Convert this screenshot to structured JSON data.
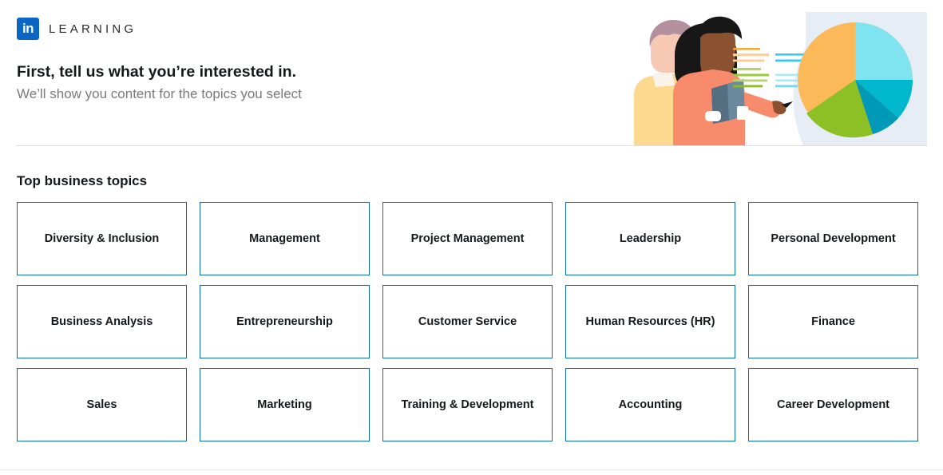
{
  "brand": {
    "mark_text": "in",
    "wordmark": "LEARNING",
    "mark_color": "#0a66c2"
  },
  "header": {
    "headline": "First, tell us what you’re interested in.",
    "subhead": "We’ll show you content for the topics you select"
  },
  "section": {
    "title": "Top business topics"
  },
  "topics": [
    {
      "label": "Diversity & Inclusion"
    },
    {
      "label": "Management"
    },
    {
      "label": "Project Management"
    },
    {
      "label": "Leadership"
    },
    {
      "label": "Personal Development"
    },
    {
      "label": "Business Analysis"
    },
    {
      "label": "Entrepreneurship"
    },
    {
      "label": "Customer Service"
    },
    {
      "label": "Human Resources (HR)"
    },
    {
      "label": "Finance"
    },
    {
      "label": "Sales"
    },
    {
      "label": "Marketing"
    },
    {
      "label": "Training & Development"
    },
    {
      "label": "Accounting"
    },
    {
      "label": "Career Development"
    }
  ],
  "illustration": {
    "name": "people-with-pie-chart-illustration",
    "backdrop_color": "#e7edf4",
    "pie": {
      "slices": [
        {
          "name": "light-cyan",
          "color": "#7fe3f0",
          "percent": 25
        },
        {
          "name": "teal",
          "color": "#00b8ce",
          "percent": 8
        },
        {
          "name": "deep-cyan",
          "color": "#0099b8",
          "percent": 10
        },
        {
          "name": "green",
          "color": "#8cc024",
          "percent": 22
        },
        {
          "name": "orange",
          "color": "#fcb95a",
          "percent": 35
        }
      ]
    },
    "text_lines": {
      "left_colors": [
        "#f5a83c",
        "#fbcf97",
        "#fbcf97",
        "#b6d46b",
        "#9ac93c",
        "#b6d46b",
        "#8cbb2a"
      ],
      "right_colors": [
        "#2ecdf0",
        "#2ecdf0",
        "#a9e9f7",
        "#a9e9f7",
        "#6fd9f2"
      ]
    },
    "figures": {
      "left_shirt": "#fcd98e",
      "left_hair": "#b4909e",
      "left_skin": "#f7c9b4",
      "right_shirt": "#f98b6d",
      "right_hair": "#171717",
      "right_skin": "#8c5130",
      "book": "#5f7d91"
    }
  }
}
